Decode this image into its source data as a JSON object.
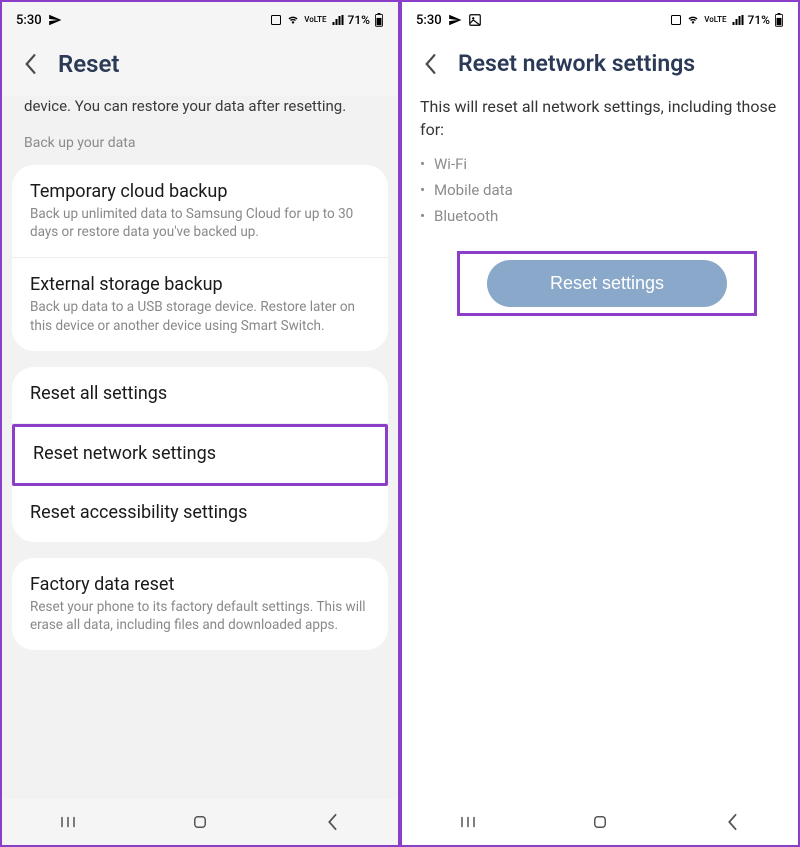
{
  "status": {
    "time": "5:30",
    "battery_pct": "71%",
    "network_label": "VoLTE"
  },
  "left": {
    "title": "Reset",
    "intro": "device. You can restore your data after resetting.",
    "backup_label": "Back up your data",
    "card1": [
      {
        "title": "Temporary cloud backup",
        "desc": "Back up unlimited data to Samsung Cloud for up to 30 days or restore data you've backed up."
      },
      {
        "title": "External storage backup",
        "desc": "Back up data to a USB storage device. Restore later on this device or another device using Smart Switch."
      }
    ],
    "card2": [
      {
        "title": "Reset all settings"
      },
      {
        "title": "Reset network settings",
        "highlighted": true
      },
      {
        "title": "Reset accessibility settings"
      }
    ],
    "card3": [
      {
        "title": "Factory data reset",
        "desc": "Reset your phone to its factory default settings. This will erase all data, including files and downloaded apps."
      }
    ]
  },
  "right": {
    "title": "Reset network settings",
    "desc": "This will reset all network settings, including those for:",
    "bullets": [
      "Wi-Fi",
      "Mobile data",
      "Bluetooth"
    ],
    "button": "Reset settings"
  },
  "status_icons_right": [
    "image-icon"
  ]
}
